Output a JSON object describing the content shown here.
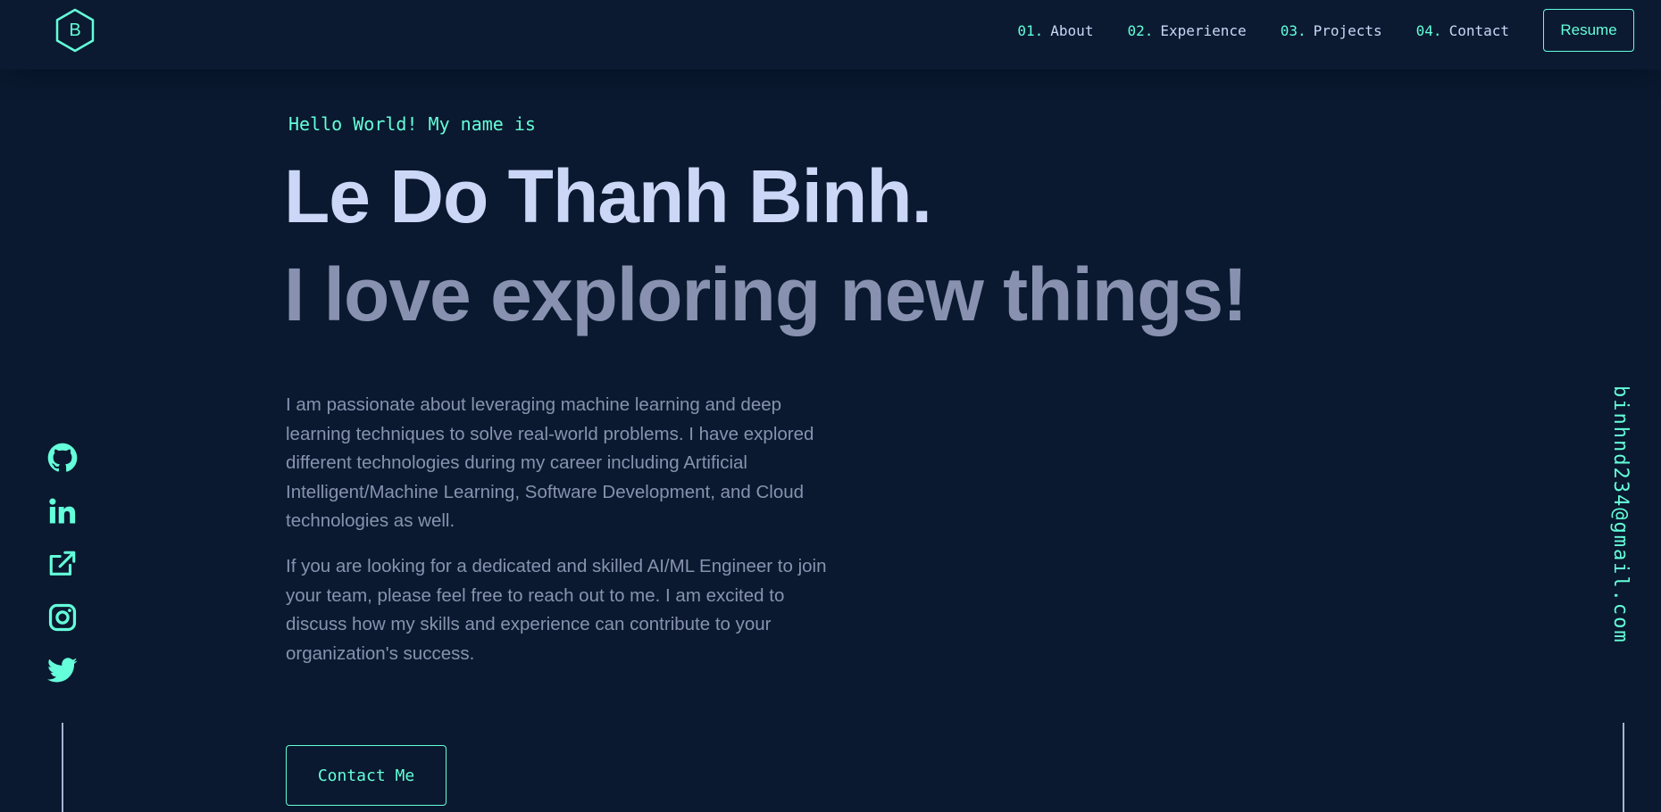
{
  "theme": {
    "background": "#0a192f",
    "accent": "#64ffda",
    "heading": "#ccd6f6",
    "muted": "#8892b0"
  },
  "header": {
    "logo_letter": "B",
    "nav": [
      {
        "num": "01.",
        "label": "About"
      },
      {
        "num": "02.",
        "label": "Experience"
      },
      {
        "num": "03.",
        "label": "Projects"
      },
      {
        "num": "04.",
        "label": "Contact"
      }
    ],
    "resume_label": "Resume"
  },
  "hero": {
    "intro": "Hello World! My name is",
    "name": "Le Do Thanh Binh.",
    "tagline": "I love exploring new things!",
    "paragraphs": [
      "I am passionate about leveraging machine learning and deep learning techniques to solve real-world problems. I have explored different technologies during my career including Artificial Intelligent/Machine Learning, Software Development, and Cloud technologies as well.",
      "If you are looking for a dedicated and skilled AI/ML Engineer to join your team, please feel free to reach out to me. I am excited to discuss how my skills and experience can contribute to your organization's success."
    ],
    "cta_label": "Contact Me"
  },
  "social": {
    "icons": [
      "github-icon",
      "linkedin-icon",
      "external-link-icon",
      "instagram-icon",
      "twitter-icon"
    ]
  },
  "email": "binhnd234@gmail.com"
}
